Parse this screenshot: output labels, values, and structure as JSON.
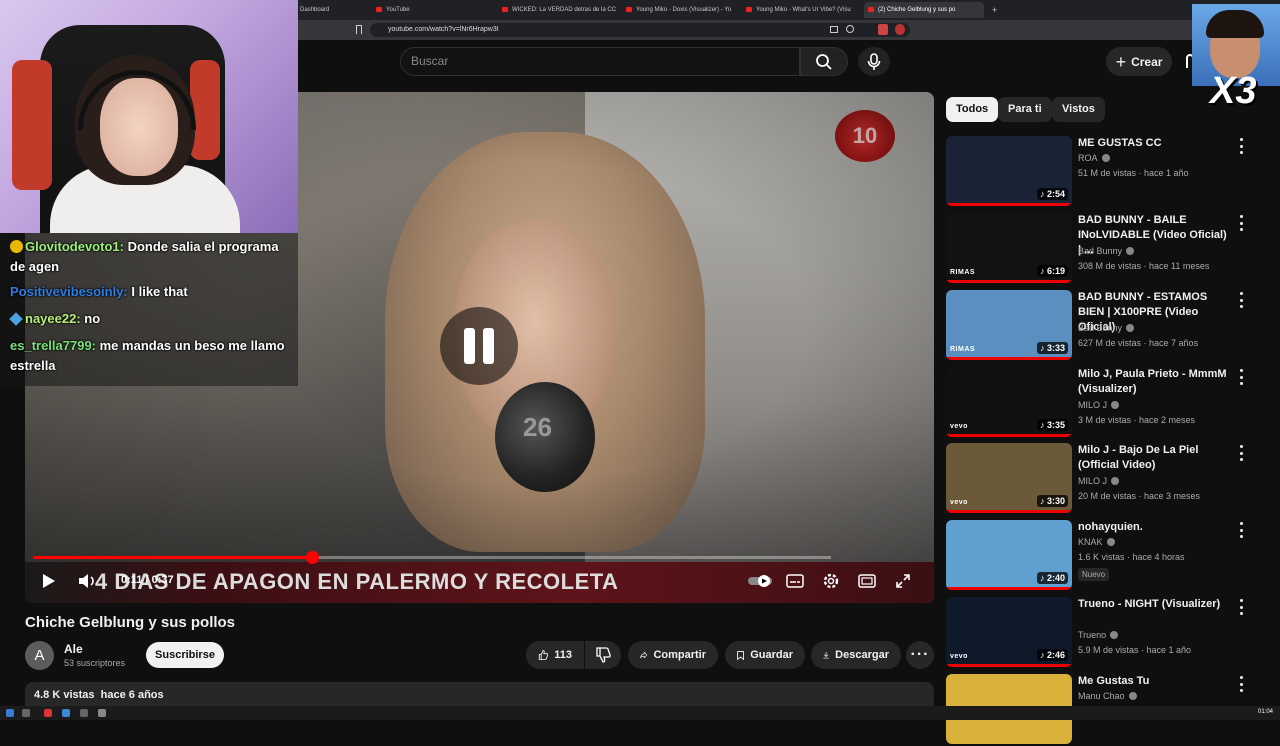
{
  "browser": {
    "tabs": [
      {
        "title": "Dashboard",
        "active": false
      },
      {
        "title": "YouTube",
        "active": false
      },
      {
        "title": "WICKED: La VERDAD detras de la CC",
        "active": false
      },
      {
        "title": "Young Miko - Doxis (Visualizer) - Yo",
        "active": false
      },
      {
        "title": "Young Miko - What's Ur Vibe? (Visu",
        "active": false
      },
      {
        "title": "(2) Chiche Gelblung y sus po",
        "active": true
      }
    ],
    "new_tab": "+",
    "url": "youtube.com/watch?v=lNr6Hrapw3I"
  },
  "header": {
    "search_placeholder": "Buscar",
    "create_label": "Crear"
  },
  "player": {
    "ticker_text": "4 DIAS DE APAGON EN PALERMO Y RECOLETA",
    "mic_logo": "26",
    "channel_logo": "10",
    "time": "0:11 / 0:37",
    "progress": 0.35
  },
  "video": {
    "title": "Chiche Gelblung y sus pollos",
    "channel_initial": "A",
    "channel_name": "Ale",
    "subscribers": "53 suscriptores",
    "subscribe_label": "Suscribirse",
    "likes": "113",
    "share_label": "Compartir",
    "save_label": "Guardar",
    "download_label": "Descargar",
    "views_line": "4.8 K vistas  hace 6 años"
  },
  "sidebar": {
    "chips": [
      {
        "label": "Todos",
        "active": true
      },
      {
        "label": "Para ti",
        "active": false
      },
      {
        "label": "Vistos",
        "active": false
      }
    ],
    "recs": [
      {
        "title": "ME GUSTAS CC",
        "channel": "ROA",
        "meta": "51 M de vistas · hace 1 año",
        "duration": "2:54",
        "brand": "",
        "thumb": "#1a2236"
      },
      {
        "title": "BAD BUNNY - BAILE INoLVIDABLE (Video Oficial) | ...",
        "channel": "Bad Bunny",
        "meta": "308 M de vistas · hace 11 meses",
        "duration": "6:19",
        "brand": "RIMAS",
        "thumb": "#121212"
      },
      {
        "title": "BAD BUNNY - ESTAMOS BIEN | X100PRE (Video Oficial)",
        "channel": "Bad Bunny",
        "meta": "627 M de vistas · hace 7 años",
        "duration": "3:33",
        "brand": "RIMAS",
        "thumb": "#5a8fc0"
      },
      {
        "title": "Milo J, Paula Prieto - MmmM (Visualizer)",
        "channel": "MILO J",
        "meta": "3 M de vistas · hace 2 meses",
        "duration": "3:35",
        "brand": "vevo",
        "thumb": "#111"
      },
      {
        "title": "Milo J - Bajo De La Piel (Official Video)",
        "channel": "MILO J",
        "meta": "20 M de vistas · hace 3 meses",
        "duration": "3:30",
        "brand": "vevo",
        "thumb": "#6a5a3a"
      },
      {
        "title": "nohayquien.",
        "channel": "KNAK",
        "meta": "1.6 K vistas · hace 4 horas",
        "duration": "2:40",
        "brand": "",
        "thumb": "#5fa0d0",
        "badge": "Nuevo"
      },
      {
        "title": "Trueno - NIGHT (Visualizer)",
        "channel": "Trueno",
        "meta": "5.9 M de vistas · hace 1 año",
        "duration": "2:46",
        "brand": "vevo",
        "thumb": "#0e1a2a"
      },
      {
        "title": "Me Gustas Tu",
        "channel": "Manu Chao",
        "meta": "",
        "duration": "",
        "brand": "",
        "thumb": "#d8b03a"
      }
    ]
  },
  "chat": {
    "messages": [
      {
        "user": "Glovitodevoto1:",
        "text": " Donde salia el programa de agen"
      },
      {
        "user": "Positivevibesoinly:",
        "text": " I like that"
      },
      {
        "user": "nayee22:",
        "text": " no"
      },
      {
        "user": "es_trella7799:",
        "text": " me mandas un beso me llamo estrella"
      }
    ]
  },
  "overlay": {
    "multiplier": "X3"
  },
  "taskbar": {
    "clock": "01:04"
  }
}
